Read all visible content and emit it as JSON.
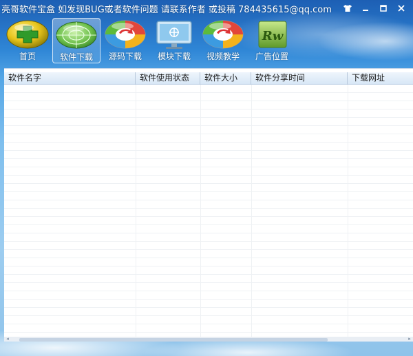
{
  "window": {
    "title": "亮哥软件宝盒  如发现BUG或者软件问题  请联系作者  或投稿  784435615@qq.com"
  },
  "window_controls": [
    {
      "name": "skin",
      "icon": "shirt-icon"
    },
    {
      "name": "minimize",
      "icon": "minimize-icon"
    },
    {
      "name": "maximize",
      "icon": "maximize-icon"
    },
    {
      "name": "close",
      "icon": "close-icon"
    }
  ],
  "toolbar": {
    "items": [
      {
        "label": "首页",
        "icon": "home-plus-icon",
        "active": false
      },
      {
        "label": "软件下载",
        "icon": "radar-icon",
        "active": true
      },
      {
        "label": "源码下载",
        "icon": "refresh-color-icon",
        "active": false
      },
      {
        "label": "模块下载",
        "icon": "monitor-icon",
        "active": false
      },
      {
        "label": "视频教学",
        "icon": "refresh-color-icon",
        "active": false
      },
      {
        "label": "广告位置",
        "icon": "rw-logo-icon",
        "active": false
      }
    ]
  },
  "table": {
    "columns": [
      "软件名字",
      "软件使用状态",
      "软件大小",
      "软件分享时间",
      "下载网址"
    ],
    "rows": []
  },
  "colors": {
    "title_bar": "#1d5fb4",
    "header_bg": "#dbe8f6",
    "list_bg": "#ffffff"
  }
}
